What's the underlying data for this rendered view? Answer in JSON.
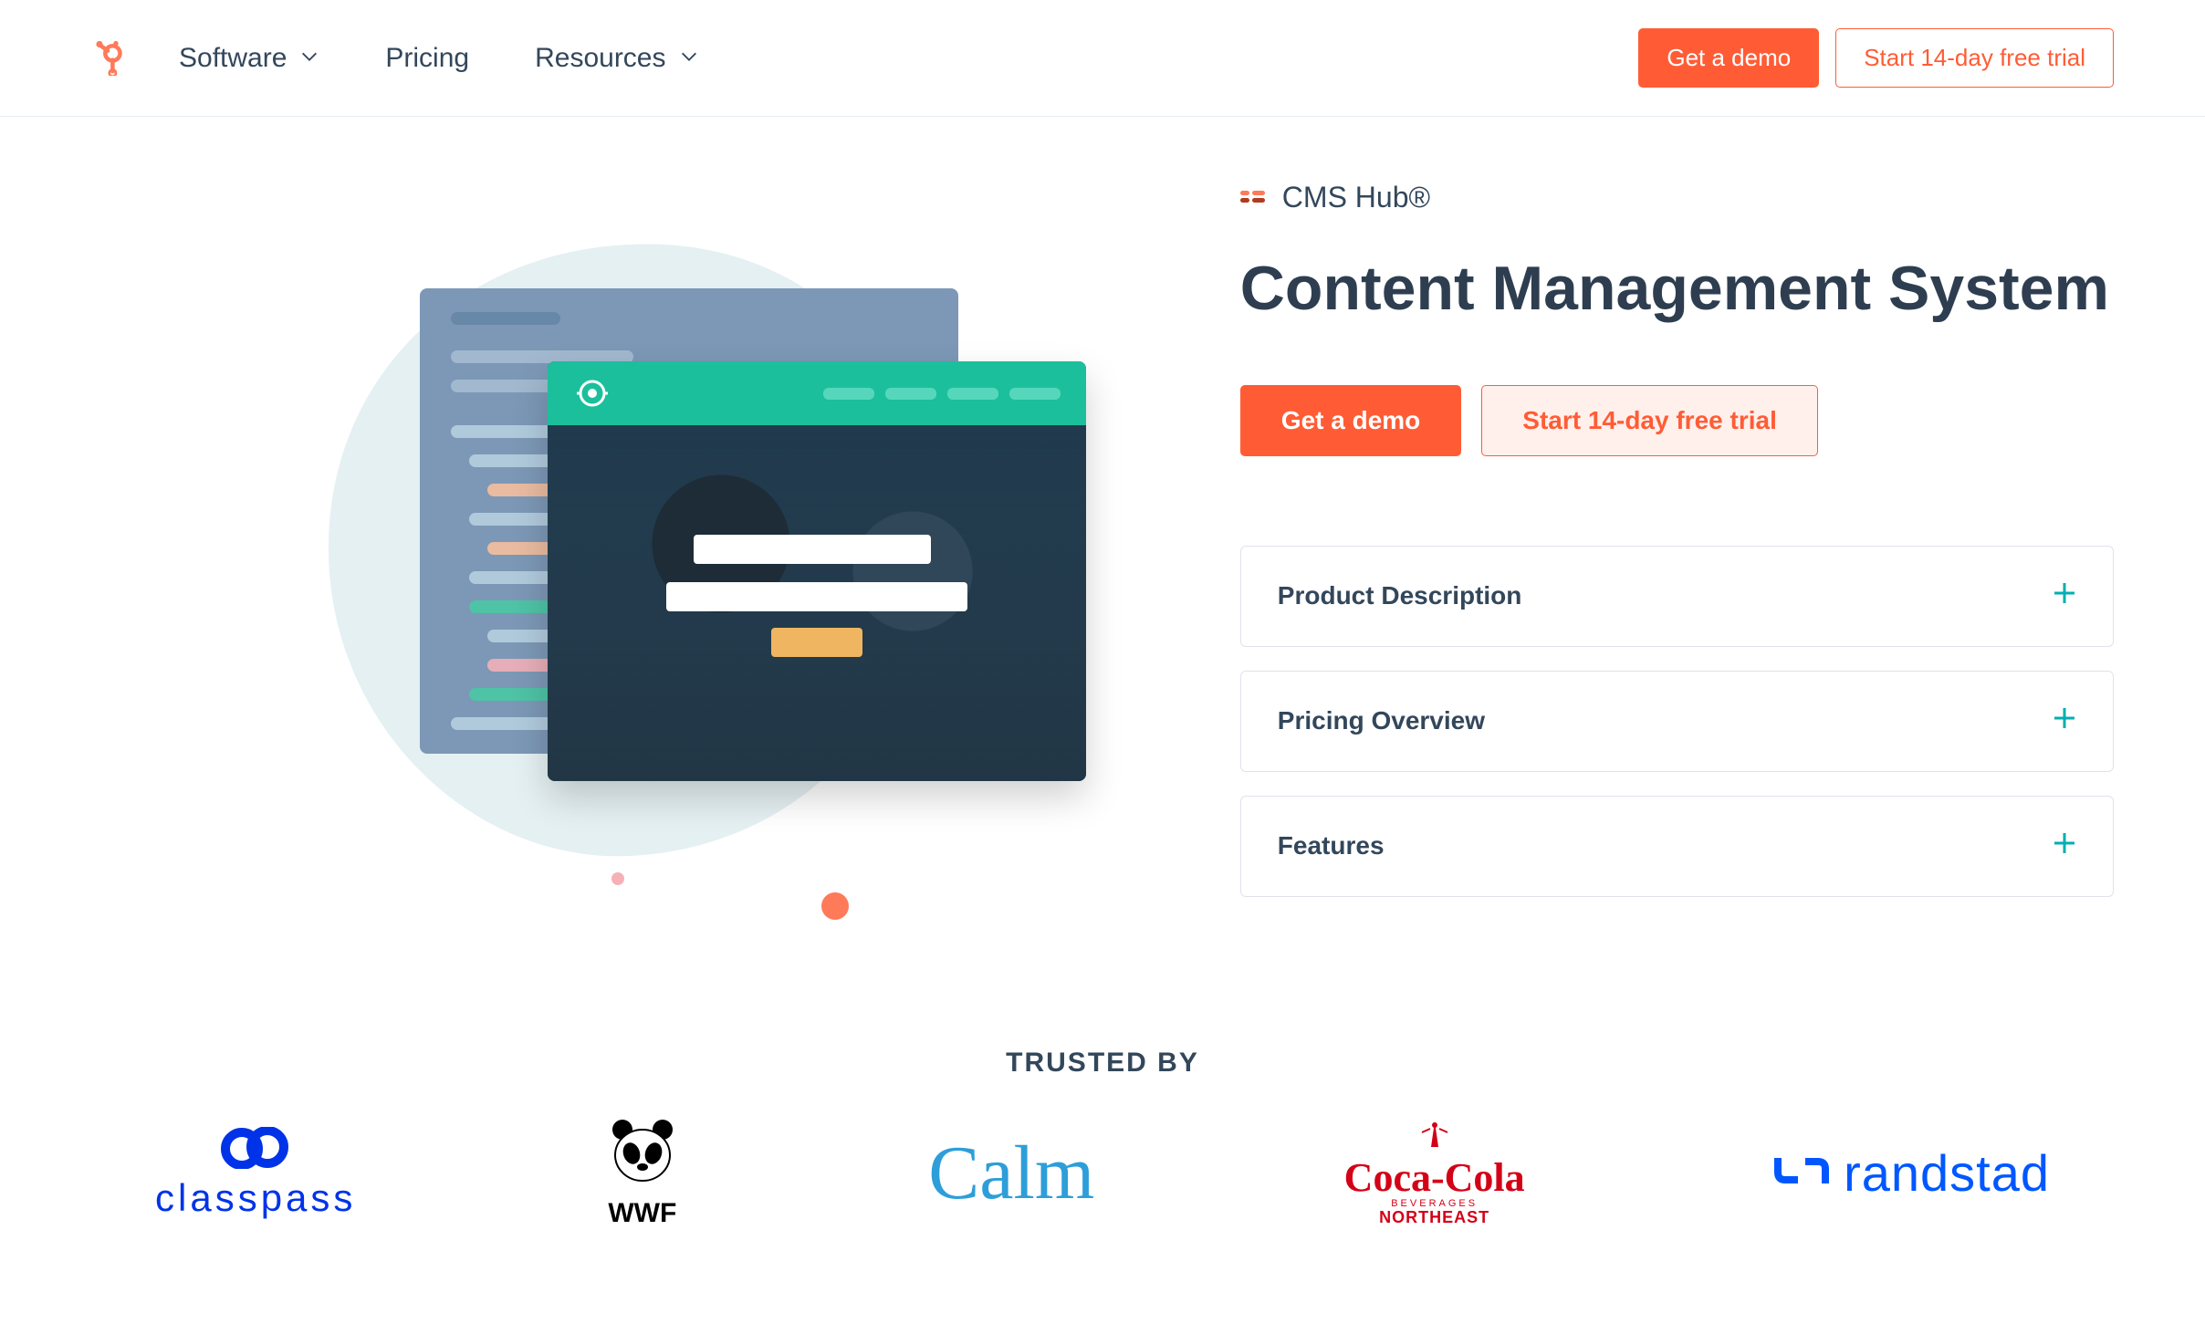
{
  "nav": {
    "items": [
      {
        "label": "Software",
        "has_menu": true
      },
      {
        "label": "Pricing",
        "has_menu": false
      },
      {
        "label": "Resources",
        "has_menu": true
      }
    ],
    "cta_primary": "Get a demo",
    "cta_secondary": "Start 14-day free trial"
  },
  "hero": {
    "product_tag": "CMS Hub®",
    "title": "Content Management System",
    "cta_primary": "Get a demo",
    "cta_secondary": "Start 14-day free trial"
  },
  "accordion": [
    {
      "label": "Product Description"
    },
    {
      "label": "Pricing Overview"
    },
    {
      "label": "Features"
    }
  ],
  "trusted": {
    "heading": "TRUSTED BY",
    "logos": [
      {
        "name": "classpass"
      },
      {
        "name": "WWF"
      },
      {
        "name": "Calm"
      },
      {
        "name_line1": "Coca-Cola",
        "name_line2": "BEVERAGES",
        "name_line3": "NORTHEAST"
      },
      {
        "name": "randstad"
      }
    ]
  },
  "colors": {
    "brand_orange": "#ff5c35",
    "text": "#33475b",
    "teal": "#1bbf9c",
    "accent_cyan": "#00afb2"
  }
}
